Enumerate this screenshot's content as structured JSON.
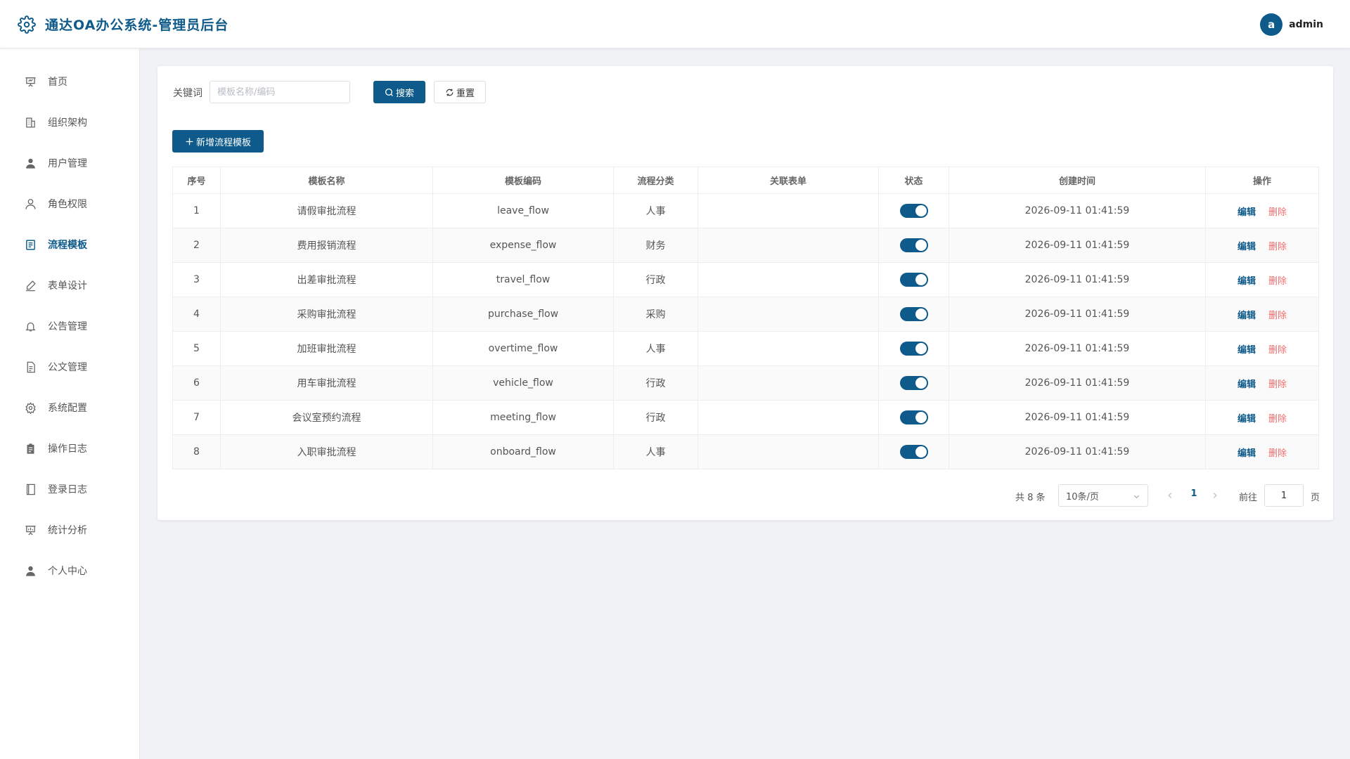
{
  "header": {
    "title": "通达OA办公系统-管理员后台",
    "avatar_letter": "a",
    "username": "admin"
  },
  "sidebar": {
    "items": [
      {
        "label": "首页",
        "icon": "presentation-icon",
        "active": false
      },
      {
        "label": "组织架构",
        "icon": "building-icon",
        "active": false
      },
      {
        "label": "用户管理",
        "icon": "user-solid-icon",
        "active": false
      },
      {
        "label": "角色权限",
        "icon": "user-outline-icon",
        "active": false
      },
      {
        "label": "流程模板",
        "icon": "document-icon",
        "active": true
      },
      {
        "label": "表单设计",
        "icon": "pen-icon",
        "active": false
      },
      {
        "label": "公告管理",
        "icon": "bell-icon",
        "active": false
      },
      {
        "label": "公文管理",
        "icon": "file-icon",
        "active": false
      },
      {
        "label": "系统配置",
        "icon": "gear-icon",
        "active": false
      },
      {
        "label": "操作日志",
        "icon": "clipboard-icon",
        "active": false
      },
      {
        "label": "登录日志",
        "icon": "notebook-icon",
        "active": false
      },
      {
        "label": "统计分析",
        "icon": "chart-board-icon",
        "active": false
      },
      {
        "label": "个人中心",
        "icon": "user-solid-icon",
        "active": false
      }
    ]
  },
  "search": {
    "label": "关键词",
    "placeholder": "模板名称/编码",
    "value": "",
    "search_button": "搜索",
    "reset_button": "重置"
  },
  "toolbar": {
    "add_button": "新增流程模板"
  },
  "table": {
    "headers": [
      "序号",
      "模板名称",
      "模板编码",
      "流程分类",
      "关联表单",
      "状态",
      "创建时间",
      "操作"
    ],
    "rows": [
      {
        "index": "1",
        "name": "请假审批流程",
        "code": "leave_flow",
        "category": "人事",
        "form": "",
        "enabled": true,
        "created": "2026-09-11 01:41:59"
      },
      {
        "index": "2",
        "name": "费用报销流程",
        "code": "expense_flow",
        "category": "财务",
        "form": "",
        "enabled": true,
        "created": "2026-09-11 01:41:59"
      },
      {
        "index": "3",
        "name": "出差审批流程",
        "code": "travel_flow",
        "category": "行政",
        "form": "",
        "enabled": true,
        "created": "2026-09-11 01:41:59"
      },
      {
        "index": "4",
        "name": "采购审批流程",
        "code": "purchase_flow",
        "category": "采购",
        "form": "",
        "enabled": true,
        "created": "2026-09-11 01:41:59"
      },
      {
        "index": "5",
        "name": "加班审批流程",
        "code": "overtime_flow",
        "category": "人事",
        "form": "",
        "enabled": true,
        "created": "2026-09-11 01:41:59"
      },
      {
        "index": "6",
        "name": "用车审批流程",
        "code": "vehicle_flow",
        "category": "行政",
        "form": "",
        "enabled": true,
        "created": "2026-09-11 01:41:59"
      },
      {
        "index": "7",
        "name": "会议室预约流程",
        "code": "meeting_flow",
        "category": "行政",
        "form": "",
        "enabled": true,
        "created": "2026-09-11 01:41:59"
      },
      {
        "index": "8",
        "name": "入职审批流程",
        "code": "onboard_flow",
        "category": "人事",
        "form": "",
        "enabled": true,
        "created": "2026-09-11 01:41:59"
      }
    ],
    "edit_label": "编辑",
    "delete_label": "删除"
  },
  "pagination": {
    "total_text": "共 8 条",
    "page_size": "10条/页",
    "current_page": "1",
    "goto_label": "前往",
    "goto_value": "1",
    "page_suffix": "页"
  },
  "colors": {
    "primary": "#0e5a8a",
    "danger": "#f56c6c",
    "background": "#f0f2f5"
  }
}
